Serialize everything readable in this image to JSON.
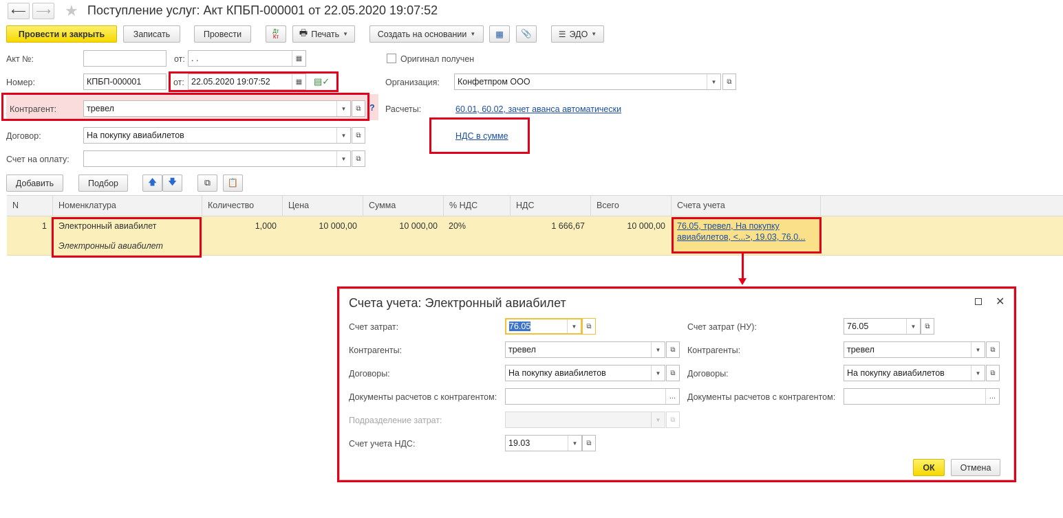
{
  "window": {
    "title": "Поступление услуг: Акт КПБП-000001 от 22.05.2020 19:07:52"
  },
  "toolbar": {
    "post_close": "Провести и закрыть",
    "save": "Записать",
    "post": "Провести",
    "dt_kt_top": "Дт",
    "dt_kt_bottom": "Кт",
    "print": "Печать",
    "create_based": "Создать на основании",
    "edo": "ЭДО"
  },
  "form": {
    "act_no_label": "Акт №:",
    "act_no_value": "",
    "from_label_1": "от:",
    "act_date_value": " .  .",
    "original_received": "Оригинал получен",
    "number_label": "Номер:",
    "number_value": "КПБП-000001",
    "from_label_2": "от:",
    "date_value": "22.05.2020 19:07:52",
    "organization_label": "Организация:",
    "organization_value": "Конфетпром ООО",
    "counterparty_label": "Контрагент:",
    "counterparty_value": "тревел",
    "help": "?",
    "settlements_label": "Расчеты:",
    "settlements_link": "60.01, 60.02, зачет аванса автоматически",
    "vat_link": "НДС в сумме",
    "contract_label": "Договор:",
    "contract_value": "На покупку авиабилетов",
    "invoice_label": "Счет на оплату:",
    "invoice_value": ""
  },
  "table_toolbar": {
    "add": "Добавить",
    "selection": "Подбор"
  },
  "table": {
    "headers": [
      "N",
      "Номенклатура",
      "Количество",
      "Цена",
      "Сумма",
      "% НДС",
      "НДС",
      "Всего",
      "Счета учета"
    ],
    "row": {
      "n": "1",
      "item": "Электронный авиабилет",
      "item_content": "Электронный авиабилет",
      "qty": "1,000",
      "price": "10 000,00",
      "sum": "10 000,00",
      "vat_rate": "20%",
      "vat": "1 666,67",
      "total": "10 000,00",
      "accounts_line1": "76.05, тревел, На покупку",
      "accounts_line2": "авиабилетов, <...>, 19.03, 76.0..."
    }
  },
  "dialog": {
    "title": "Счета учета: Электронный авиабилет",
    "cost_account_label": "Счет затрат:",
    "cost_account_value": "76.05",
    "counterparties_label": "Контрагенты:",
    "counterparties_value": "тревел",
    "contracts_label": "Договоры:",
    "contracts_value": "На покупку авиабилетов",
    "docs_label": "Документы расчетов с контрагентом:",
    "docs_value": "",
    "division_label": "Подразделение затрат:",
    "division_value": "",
    "vat_account_label": "Счет учета НДС:",
    "vat_account_value": "19.03",
    "cost_account_nu_label": "Счет затрат (НУ):",
    "cost_account_nu_value": "76.05",
    "counterparties_nu_label": "Контрагенты:",
    "counterparties_nu_value": "тревел",
    "contracts_nu_label": "Договоры:",
    "contracts_nu_value": "На покупку авиабилетов",
    "docs_nu_label": "Документы расчетов с контрагентом:",
    "docs_nu_value": "",
    "ok": "ОК",
    "cancel": "Отмена"
  },
  "colors": {
    "highlight_red": "#e2001a",
    "primary_yellow": "#f5d800",
    "row_selected": "#fbefbc",
    "counterparty_bg": "#fadcdc",
    "link_blue": "#1c4fa0"
  }
}
